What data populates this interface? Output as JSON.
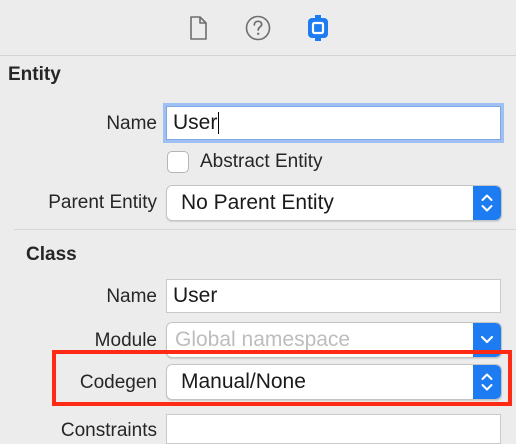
{
  "toolbar": {
    "icons": [
      "file-inspector-icon",
      "quick-help-icon",
      "data-model-inspector-icon"
    ]
  },
  "entity": {
    "section_title": "Entity",
    "name_label": "Name",
    "name_value": "User",
    "abstract_label": "Abstract Entity",
    "abstract_checked": false,
    "parent_label": "Parent Entity",
    "parent_value": "No Parent Entity"
  },
  "class": {
    "section_title": "Class",
    "name_label": "Name",
    "name_value": "User",
    "module_label": "Module",
    "module_placeholder": "Global namespace",
    "codegen_label": "Codegen",
    "codegen_value": "Manual/None",
    "constraints_label": "Constraints"
  },
  "colors": {
    "accent": "#1d7cf2",
    "highlight": "#ff2a14",
    "focus_ring": "#9ec0f3"
  }
}
